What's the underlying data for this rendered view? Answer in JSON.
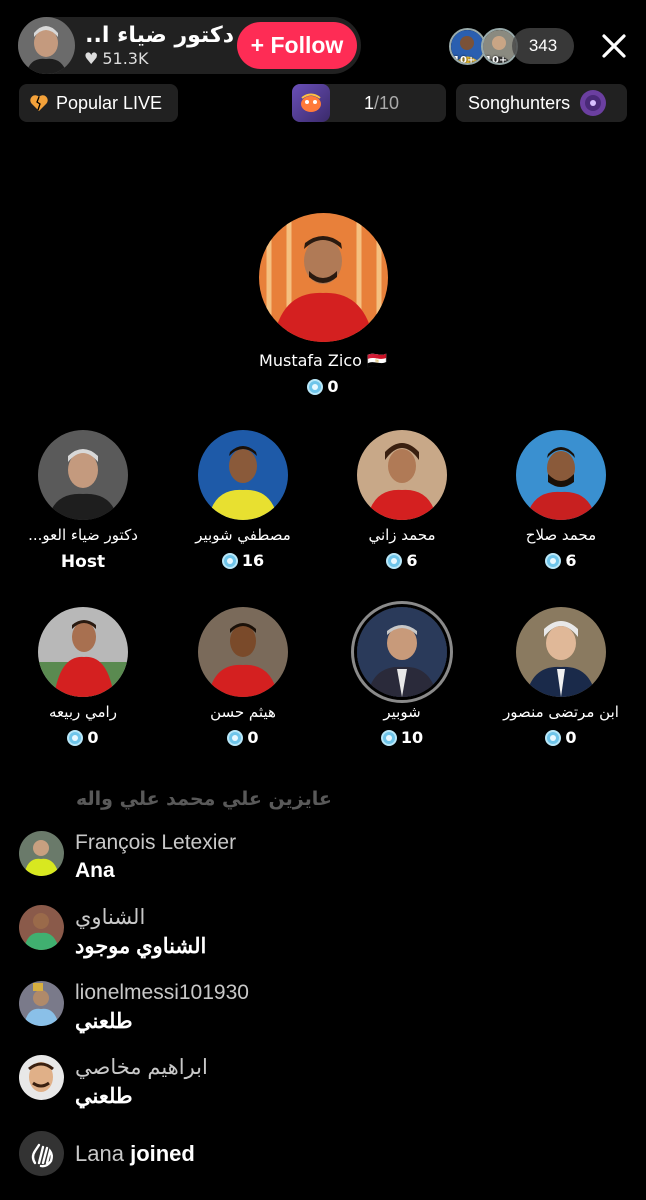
{
  "header": {
    "host_name": "دكتور ضياء ا...",
    "likes": "51.3K",
    "follow_label": "+ Follow",
    "viewer_badges": [
      "10+",
      "10+"
    ],
    "viewer_count": "343"
  },
  "tags": {
    "popular": "Popular LIVE",
    "rank_current": "1",
    "rank_total": "/10",
    "song": "Songhunters"
  },
  "featured": {
    "name": "Mustafa Zico 🇪🇬",
    "score": "0"
  },
  "guests_row1": [
    {
      "name": "دكتور ضياء العو...",
      "role": "Host"
    },
    {
      "name": "مصطفي شوبير",
      "score": "16"
    },
    {
      "name": "محمد زاني",
      "score": "6"
    },
    {
      "name": "محمد صلاح",
      "score": "6"
    }
  ],
  "guests_row2": [
    {
      "name": "رامي ربيعه",
      "score": "0"
    },
    {
      "name": "هيثم حسن",
      "score": "0"
    },
    {
      "name": "شوبير",
      "score": "10"
    },
    {
      "name": "ابن مرتضى منصور",
      "score": "0"
    }
  ],
  "chat": {
    "faded": "عايزين علي محمد علي واله",
    "messages": [
      {
        "user": "François Letexier",
        "text": "Ana"
      },
      {
        "user": "الشناوي",
        "text": "الشناوي موجود"
      },
      {
        "user": "lionelmessi101930",
        "text": "طلعني"
      },
      {
        "user": "ابراهيم مخاصي",
        "text": "طلعني"
      }
    ],
    "joined_name": "Lana",
    "joined_verb": "joined"
  },
  "colors": {
    "follow": "#fe2c55",
    "coin": "#6fc5ea"
  }
}
